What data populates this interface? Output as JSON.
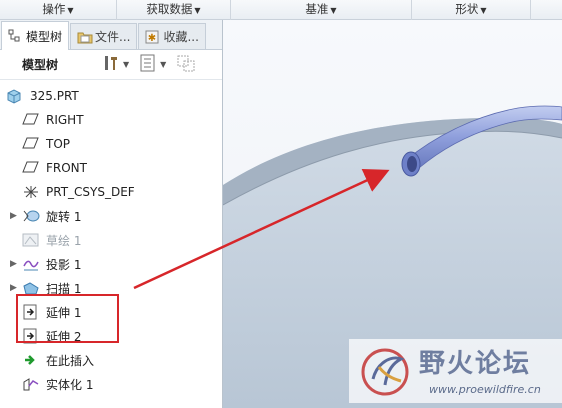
{
  "menubar": {
    "items": [
      "操作",
      "获取数据",
      "基准",
      "形状"
    ]
  },
  "panel": {
    "tabs": [
      {
        "label": "模型树",
        "icon": "model-tree-icon"
      },
      {
        "label": "文件...",
        "icon": "folder-icon"
      },
      {
        "label": "收藏...",
        "icon": "favorites-icon"
      }
    ],
    "toolbar_title": "模型树"
  },
  "tree": {
    "root": "325.PRT",
    "items": [
      {
        "label": "RIGHT",
        "icon": "datum-plane-icon"
      },
      {
        "label": "TOP",
        "icon": "datum-plane-icon"
      },
      {
        "label": "FRONT",
        "icon": "datum-plane-icon"
      },
      {
        "label": "PRT_CSYS_DEF",
        "icon": "coordinate-system-icon"
      },
      {
        "label": "旋转 1",
        "icon": "revolve-icon"
      },
      {
        "label": "草绘 1",
        "icon": "sketch-icon"
      },
      {
        "label": "投影 1",
        "icon": "projection-icon"
      },
      {
        "label": "扫描 1",
        "icon": "sweep-icon"
      },
      {
        "label": "延伸 1",
        "icon": "extend-icon"
      },
      {
        "label": "延伸 2",
        "icon": "extend-icon"
      },
      {
        "label": "在此插入",
        "icon": "insert-here-arrow-icon"
      },
      {
        "label": "实体化 1",
        "icon": "solidify-icon"
      }
    ]
  },
  "watermark": {
    "title": "野火论坛",
    "url": "www.proewildfire.cn"
  },
  "colors": {
    "annotation_red": "#d7262a",
    "tube_blue": "#8e9fd9",
    "viewport_bg": "#c3cfdc"
  }
}
